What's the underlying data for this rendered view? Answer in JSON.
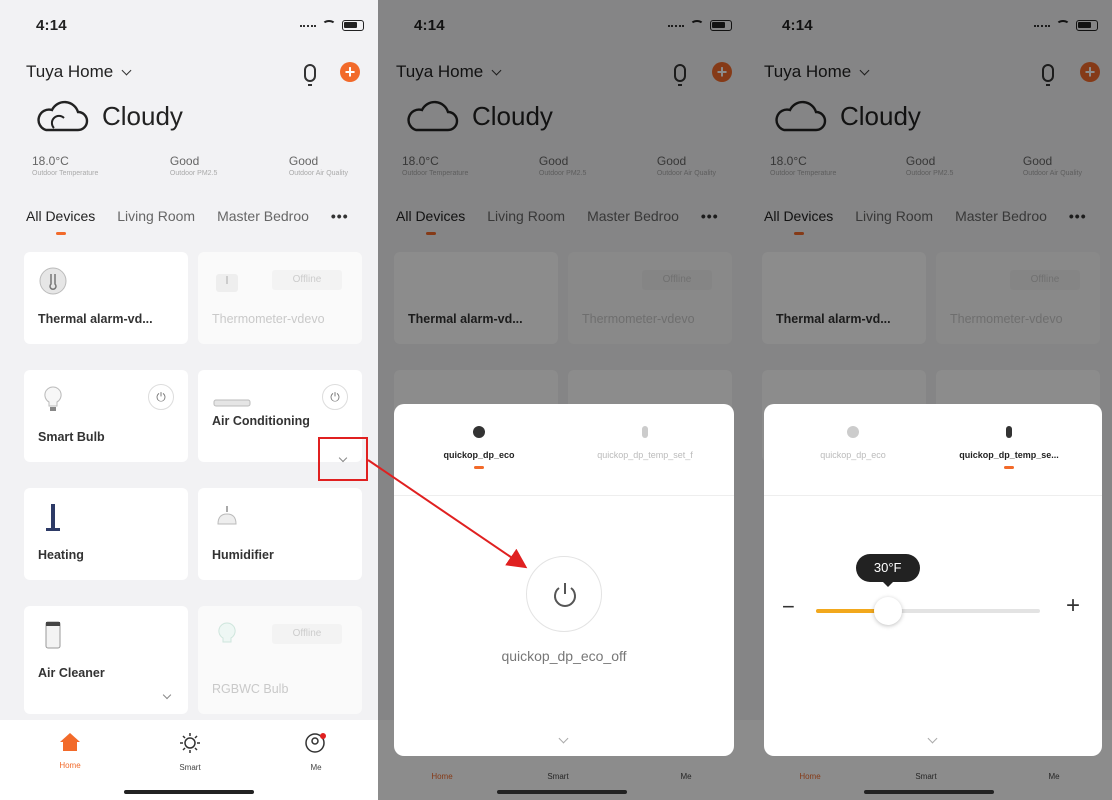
{
  "status": {
    "time": "4:14"
  },
  "header": {
    "home_name": "Tuya Home"
  },
  "weather": {
    "condition": "Cloudy",
    "stats": [
      {
        "value": "18.0°C",
        "label": "Outdoor Temperature"
      },
      {
        "value": "Good",
        "label": "Outdoor PM2.5"
      },
      {
        "value": "Good",
        "label": "Outdoor Air Quality"
      }
    ]
  },
  "tabs": {
    "all": "All Devices",
    "living": "Living Room",
    "master": "Master Bedroo",
    "more": "•••"
  },
  "devices": {
    "thermal": "Thermal alarm-vd...",
    "thermometer": "Thermometer-vdevo",
    "bulb": "Smart Bulb",
    "ac": "Air Conditioning",
    "heating": "Heating",
    "humidifier": "Humidifier",
    "cleaner": "Air Cleaner",
    "rgbwc": "RGBWC Bulb",
    "offline": "Offline"
  },
  "nav": {
    "home": "Home",
    "smart": "Smart",
    "me": "Me"
  },
  "sheet": {
    "tab_eco": "quickop_dp_eco",
    "tab_temp_full": "quickop_dp_temp_set_f",
    "tab_eco_dim": "quickop_dp_eco",
    "tab_temp_short": "quickop_dp_temp_se...",
    "power_label": "quickop_dp_eco_off",
    "temp_value": "30°F",
    "slider_fraction": 0.32
  },
  "colors": {
    "accent": "#f26a2a",
    "slider": "#f2a81d",
    "callout": "#e02020"
  }
}
